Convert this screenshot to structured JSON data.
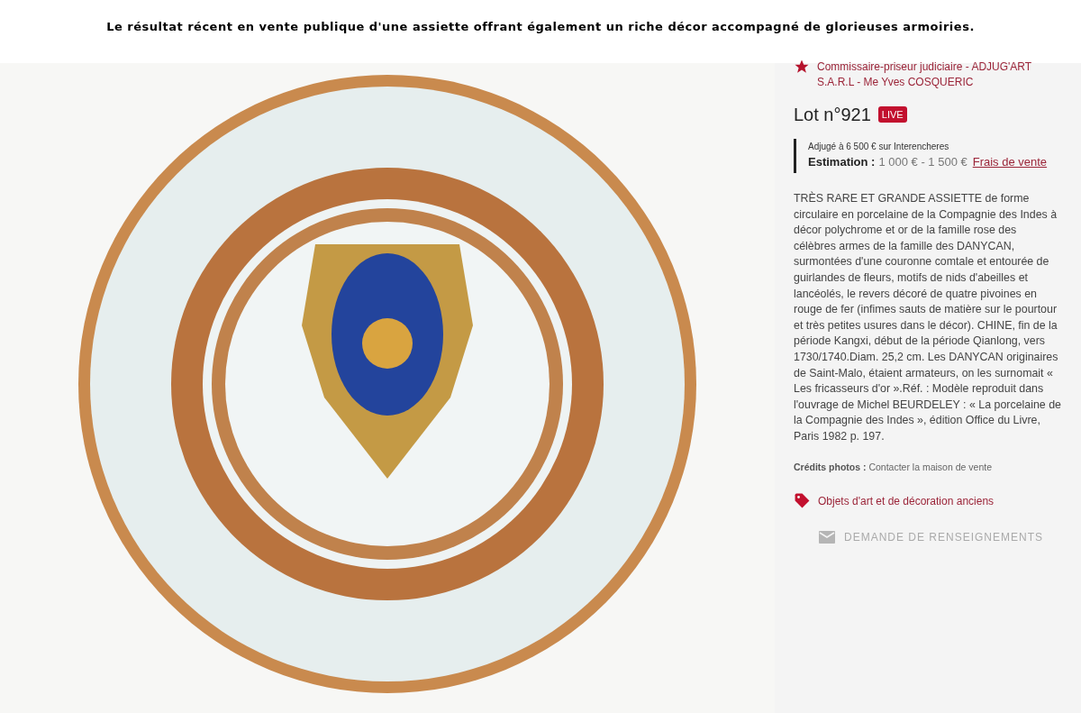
{
  "caption": "Le résultat récent en vente publique d'une assiette offrant également un riche décor accompagné de glorieuses armoiries.",
  "auctioneer": "Commissaire-priseur judiciaire - ADJUG'ART S.A.R.L - Me Yves COSQUERIC",
  "lot": {
    "title": "Lot n°921",
    "badge": "LIVE"
  },
  "sale": {
    "result": "Adjugé à 6 500 € sur Interencheres",
    "estimation_label": "Estimation :",
    "estimation_value": "1 000 € - 1 500 €",
    "fees_link": "Frais de vente"
  },
  "description": "TRÈS RARE ET GRANDE ASSIETTE de forme circulaire en porcelaine de la Compagnie des Indes à décor polychrome et or de la famille rose des célèbres armes de la famille des DANYCAN, surmontées d'une couronne comtale et entourée de guirlandes de fleurs, motifs de nids d'abeilles et lancéolés, le revers décoré de quatre pivoines en rouge de fer (infimes sauts de matière sur le pourtour et très petites usures dans le décor). CHINE, fin de la période Kangxi, début de la période Qianlong, vers 1730/1740.Diam. 25,2 cm. Les DANYCAN originaires de Saint-Malo, étaient armateurs, on les surnomait « Les fricasseurs d'or ».Réf. : Modèle reproduit dans l'ouvrage de Michel BEURDELEY : « La porcelaine de la Compagnie des Indes », édition Office du Livre, Paris 1982 p. 197.",
  "credits": {
    "label": "Crédits photos :",
    "value": "Contacter la maison de vente"
  },
  "category": "Objets d'art et de décoration anciens",
  "inquiry_button": "DEMANDE DE RENSEIGNEMENTS"
}
